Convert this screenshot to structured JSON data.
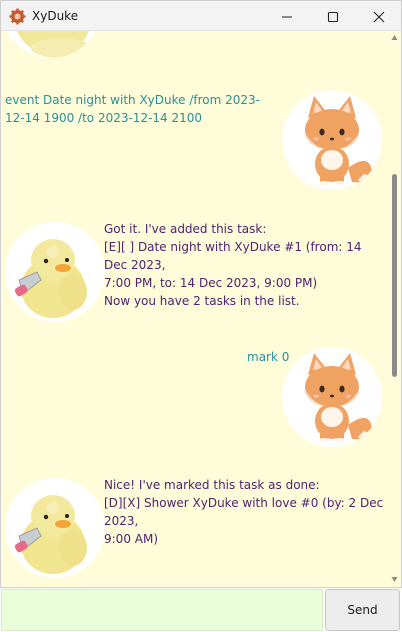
{
  "window": {
    "title": "XyDuke",
    "icon": "gear-icon",
    "controls": [
      "minimize-icon",
      "maximize-icon",
      "close-icon"
    ]
  },
  "chat": {
    "background": "#fffdd9",
    "user_text_color": "#2a8f98",
    "bot_text_color": "#4e2270",
    "messages": [
      {
        "sender": "user",
        "text": "event Date night with XyDuke /from 2023-12-14 1900 /to 2023-12-14 2100",
        "avatar": "fox-avatar"
      },
      {
        "sender": "bot",
        "lines": [
          "Got it. I've added this task:",
          "[E][ ] Date night with XyDuke #1 (from: 14 Dec 2023,",
          "7:00 PM, to: 14 Dec 2023, 9:00 PM)",
          "Now you have 2 tasks in the list."
        ],
        "avatar": "duck-avatar"
      },
      {
        "sender": "user",
        "text": "mark 0",
        "avatar": "fox-avatar"
      },
      {
        "sender": "bot",
        "lines": [
          "Nice! I've marked this task as done:",
          "[D][X] Shower XyDuke with love #0 (by: 2 Dec 2023,",
          "9:00 AM)"
        ],
        "avatar": "duck-avatar"
      }
    ]
  },
  "input": {
    "value": "",
    "background": "#e8ffd9"
  },
  "send_button": {
    "label": "Send"
  }
}
